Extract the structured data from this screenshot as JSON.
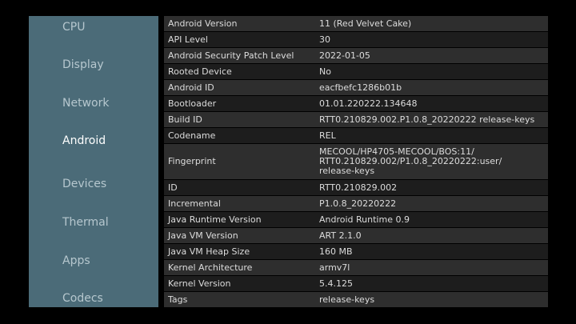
{
  "sidebar": {
    "items": [
      {
        "label": "CPU"
      },
      {
        "label": "Display"
      },
      {
        "label": "Network"
      },
      {
        "label": "Android"
      },
      {
        "label": "Devices"
      },
      {
        "label": "Thermal"
      },
      {
        "label": "Apps"
      },
      {
        "label": "Codecs"
      }
    ],
    "active": "Android"
  },
  "details": {
    "rows": [
      {
        "key": "Android Version",
        "value": "11 (Red Velvet Cake)"
      },
      {
        "key": "API Level",
        "value": "30"
      },
      {
        "key": "Android Security Patch Level",
        "value": "2022-01-05"
      },
      {
        "key": "Rooted Device",
        "value": "No"
      },
      {
        "key": "Android ID",
        "value": "eacfbefc1286b01b"
      },
      {
        "key": "Bootloader",
        "value": "01.01.220222.134648"
      },
      {
        "key": "Build ID",
        "value": "RTT0.210829.002.P1.0.8_20220222 release-keys"
      },
      {
        "key": "Codename",
        "value": "REL"
      },
      {
        "key": "Fingerprint",
        "value": "MECOOL/HP4705-MECOOL/BOS:11/\nRTT0.210829.002/P1.0.8_20220222:user/\nrelease-keys"
      },
      {
        "key": "ID",
        "value": "RTT0.210829.002"
      },
      {
        "key": "Incremental",
        "value": "P1.0.8_20220222"
      },
      {
        "key": "Java Runtime Version",
        "value": "Android Runtime 0.9"
      },
      {
        "key": "Java VM Version",
        "value": "ART 2.1.0"
      },
      {
        "key": "Java VM Heap Size",
        "value": "160 MB"
      },
      {
        "key": "Kernel Architecture",
        "value": "armv7l"
      },
      {
        "key": "Kernel Version",
        "value": "5.4.125"
      },
      {
        "key": "Tags",
        "value": "release-keys"
      }
    ]
  },
  "colors": {
    "sidebar_bg": "#4b6b78",
    "row_odd": "#2e2e2e",
    "row_even": "#1d1d1d",
    "text": "#dcdcdc",
    "active_text": "#ffffff",
    "inactive_text": "#b6c7ce"
  }
}
